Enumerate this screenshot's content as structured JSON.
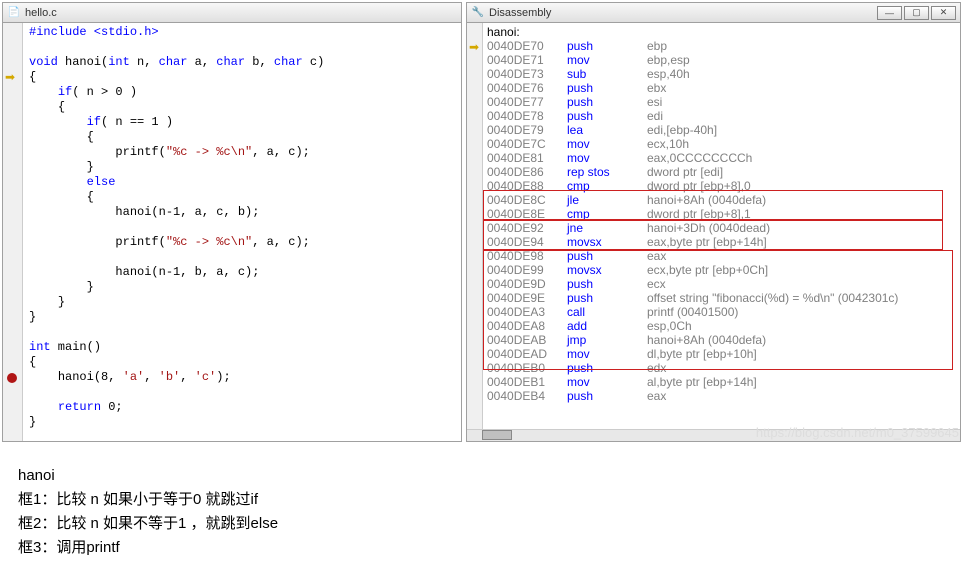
{
  "left": {
    "title": "hello.c",
    "gutter_arrow_line": 3,
    "gutter_bp_line": 23,
    "code": {
      "l0": "#include <stdio.h>",
      "l2_void": "void",
      "l2_name": " hanoi(",
      "l2_int": "int",
      "l2_rest1": " n, ",
      "l2_char": "char",
      "l2_rest2": " a, ",
      "l2_rest3": " b, ",
      "l2_rest4": " c)",
      "l3": "{",
      "l4_if": "if",
      "l4_rest": "( n > 0 )",
      "l5": "{",
      "l6_if": "if",
      "l6_rest": "( n == 1 )",
      "l7": "{",
      "l8_fn": "printf(",
      "l8_str": "\"%c -> %c\\n\"",
      "l8_rest": ", a, c);",
      "l9": "}",
      "l10_else": "else",
      "l11": "{",
      "l12": "hanoi(n-1, a, c, b);",
      "l13_fn": "printf(",
      "l13_str": "\"%c -> %c\\n\"",
      "l13_rest": ", a, c);",
      "l14": "hanoi(n-1, b, a, c);",
      "l15": "}",
      "l16": "}",
      "l17": "}",
      "l19_int": "int",
      "l19_rest": " main()",
      "l20": "{",
      "l21_a": "hanoi(8, ",
      "l21_s1": "'a'",
      "l21_c1": ", ",
      "l21_s2": "'b'",
      "l21_c2": ", ",
      "l21_s3": "'c'",
      "l21_c3": ");",
      "l23_ret": "return",
      "l23_rest": " 0;",
      "l24": "}"
    }
  },
  "right": {
    "title": "Disassembly",
    "label": "hanoi:",
    "rows": [
      {
        "addr": "0040DE70",
        "op": "push",
        "arg": "ebp"
      },
      {
        "addr": "0040DE71",
        "op": "mov",
        "arg": "ebp,esp"
      },
      {
        "addr": "0040DE73",
        "op": "sub",
        "arg": "esp,40h"
      },
      {
        "addr": "0040DE76",
        "op": "push",
        "arg": "ebx"
      },
      {
        "addr": "0040DE77",
        "op": "push",
        "arg": "esi"
      },
      {
        "addr": "0040DE78",
        "op": "push",
        "arg": "edi"
      },
      {
        "addr": "0040DE79",
        "op": "lea",
        "arg": "edi,[ebp-40h]"
      },
      {
        "addr": "0040DE7C",
        "op": "mov",
        "arg": "ecx,10h"
      },
      {
        "addr": "0040DE81",
        "op": "mov",
        "arg": "eax,0CCCCCCCCh"
      },
      {
        "addr": "0040DE86",
        "op": "rep stos",
        "arg": "dword ptr [edi]"
      },
      {
        "addr": "0040DE88",
        "op": "cmp",
        "arg": "dword ptr [ebp+8],0"
      },
      {
        "addr": "0040DE8C",
        "op": "jle",
        "arg": "hanoi+8Ah (0040defa)"
      },
      {
        "addr": "0040DE8E",
        "op": "cmp",
        "arg": "dword ptr [ebp+8],1"
      },
      {
        "addr": "0040DE92",
        "op": "jne",
        "arg": "hanoi+3Dh (0040dead)"
      },
      {
        "addr": "0040DE94",
        "op": "movsx",
        "arg": "eax,byte ptr [ebp+14h]"
      },
      {
        "addr": "0040DE98",
        "op": "push",
        "arg": "eax"
      },
      {
        "addr": "0040DE99",
        "op": "movsx",
        "arg": "ecx,byte ptr [ebp+0Ch]"
      },
      {
        "addr": "0040DE9D",
        "op": "push",
        "arg": "ecx"
      },
      {
        "addr": "0040DE9E",
        "op": "push",
        "arg": "offset string \"fibonacci(%d) = %d\\n\" (0042301c)"
      },
      {
        "addr": "0040DEA3",
        "op": "call",
        "arg": "printf (00401500)"
      },
      {
        "addr": "0040DEA8",
        "op": "add",
        "arg": "esp,0Ch"
      },
      {
        "addr": "0040DEAB",
        "op": "jmp",
        "arg": "hanoi+8Ah (0040defa)"
      },
      {
        "addr": "0040DEAD",
        "op": "mov",
        "arg": "dl,byte ptr [ebp+10h]"
      },
      {
        "addr": "0040DEB0",
        "op": "push",
        "arg": "edx"
      },
      {
        "addr": "0040DEB1",
        "op": "mov",
        "arg": "al,byte ptr [ebp+14h]"
      },
      {
        "addr": "0040DEB4",
        "op": "push",
        "arg": "eax"
      }
    ]
  },
  "notes": {
    "l1": "hanoi",
    "l2": "框1：比较 n 如果小于等于0 就跳过if",
    "l3": "框2：比较 n 如果不等于1 ，就跳到else",
    "l4": "框3：调用printf"
  },
  "watermark": "https://blog.csdn.net/m0_37599645"
}
